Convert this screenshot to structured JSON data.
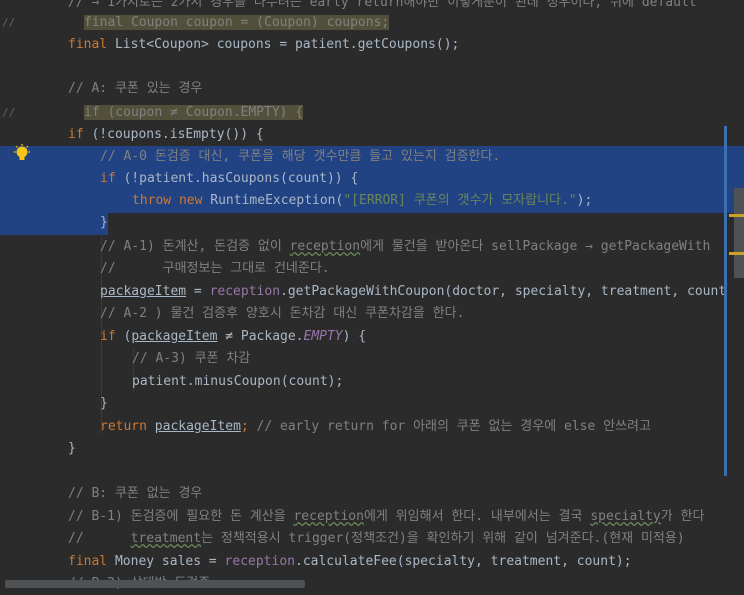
{
  "editor": {
    "lines": [
      {
        "gutter": "",
        "parts": [
          {
            "t": "// → 1가지로는 2가지 경우를 나누려는 early return해야만 이렇게분이 된데 정우이다, 뒤에 default",
            "c": "cm"
          }
        ]
      },
      {
        "gutter": "//",
        "parts": [
          {
            "t": "final Coupon coupon = (Coupon) coupons;",
            "c": "cm hl"
          }
        ]
      },
      {
        "gutter": "",
        "parts": [
          {
            "t": "final ",
            "c": "kw"
          },
          {
            "t": "List<Coupon> coupons = patient.getCoupons();",
            "c": ""
          }
        ]
      },
      {
        "gutter": "",
        "parts": []
      },
      {
        "gutter": "",
        "parts": [
          {
            "t": "// A: 쿠폰 있는 경우",
            "c": "cm"
          }
        ]
      },
      {
        "gutter": "//",
        "parts": [
          {
            "t": "if (coupon ≠ Coupon.EMPTY) {",
            "c": "cm hl"
          }
        ]
      },
      {
        "gutter": "",
        "parts": [
          {
            "t": "if ",
            "c": "kw"
          },
          {
            "t": "(!coupons.isEmpty()) {",
            "c": ""
          }
        ]
      },
      {
        "gutter": "",
        "parts": [
          {
            "t": "// A-0 돈검증 대신, 쿠폰을 해당 갯수만큼 들고 있는지 검증한다.",
            "c": "cm"
          }
        ]
      },
      {
        "gutter": "",
        "parts": [
          {
            "t": "if ",
            "c": "kw"
          },
          {
            "t": "(!patient.hasCoupons(count)) {",
            "c": ""
          }
        ]
      },
      {
        "gutter": "",
        "parts": [
          {
            "t": "throw new ",
            "c": "kw"
          },
          {
            "t": "RuntimeException(",
            "c": ""
          },
          {
            "t": "\"[ERROR] 쿠폰의 갯수가 모자랍니다.\"",
            "c": "str"
          },
          {
            "t": ");",
            "c": ""
          }
        ]
      },
      {
        "gutter": "",
        "parts": [
          {
            "t": "}",
            "c": ""
          }
        ]
      },
      {
        "gutter": "",
        "parts": [
          {
            "t": "// A-1) 돈계산, 돈검증 없이 ",
            "c": "cm"
          },
          {
            "t": "reception",
            "c": "cm sq"
          },
          {
            "t": "에게 물건을 받아온다 sellPackage → getPackageWith",
            "c": "cm"
          }
        ]
      },
      {
        "gutter": "",
        "parts": [
          {
            "t": "//      구매정보는 그대로 건네준다.",
            "c": "cm"
          }
        ]
      },
      {
        "gutter": "",
        "parts": [
          {
            "t": "packageItem",
            "c": "ul"
          },
          {
            "t": " = ",
            "c": ""
          },
          {
            "t": "reception",
            "c": "fld"
          },
          {
            "t": ".getPackageWithCoupon(doctor, specialty, treatment, count",
            "c": ""
          }
        ]
      },
      {
        "gutter": "",
        "parts": [
          {
            "t": "// A-2 ) 물건 검증후 양호시 돈차감 대신 쿠폰차감을 한다.",
            "c": "cm"
          }
        ]
      },
      {
        "gutter": "",
        "parts": [
          {
            "t": "if ",
            "c": "kw"
          },
          {
            "t": "(",
            "c": ""
          },
          {
            "t": "packageItem",
            "c": "ul"
          },
          {
            "t": " ≠ Package.",
            "c": ""
          },
          {
            "t": "EMPTY",
            "c": "it"
          },
          {
            "t": ") {",
            "c": ""
          }
        ]
      },
      {
        "gutter": "",
        "parts": [
          {
            "t": "// A-3) 쿠폰 차감",
            "c": "cm"
          }
        ]
      },
      {
        "gutter": "",
        "parts": [
          {
            "t": "patient.minusCoupon(count);",
            "c": ""
          }
        ]
      },
      {
        "gutter": "",
        "parts": [
          {
            "t": "}",
            "c": ""
          }
        ]
      },
      {
        "gutter": "",
        "parts": [
          {
            "t": "return ",
            "c": "kw"
          },
          {
            "t": "packageItem",
            "c": "ul"
          },
          {
            "t": "; ",
            "c": "kw"
          },
          {
            "t": "// early return for 아래의 쿠폰 없는 경우에 else 안쓰려고",
            "c": "cm"
          }
        ]
      },
      {
        "gutter": "",
        "parts": [
          {
            "t": "}",
            "c": ""
          }
        ]
      },
      {
        "gutter": "",
        "parts": []
      },
      {
        "gutter": "",
        "parts": [
          {
            "t": "// B: 쿠폰 없는 경우",
            "c": "cm"
          }
        ]
      },
      {
        "gutter": "",
        "parts": [
          {
            "t": "// B-1) 돈검증에 필요한 돈 계산을 ",
            "c": "cm"
          },
          {
            "t": "reception",
            "c": "cm sq"
          },
          {
            "t": "에게 위임해서 한다. 내부에서는 결국 ",
            "c": "cm"
          },
          {
            "t": "specialty",
            "c": "cm sq"
          },
          {
            "t": "가 한다",
            "c": "cm"
          }
        ]
      },
      {
        "gutter": "",
        "parts": [
          {
            "t": "//      ",
            "c": "cm"
          },
          {
            "t": "treatment",
            "c": "cm sq"
          },
          {
            "t": "는 정책적용시 trigger(정책조건)을 확인하기 위해 같이 넘겨준다.(현재 미적용)",
            "c": "cm"
          }
        ]
      },
      {
        "gutter": "",
        "parts": [
          {
            "t": "final ",
            "c": "kw"
          },
          {
            "t": "Money sales = ",
            "c": ""
          },
          {
            "t": "reception",
            "c": "fld"
          },
          {
            "t": ".calculateFee(specialty, treatment, count);",
            "c": ""
          }
        ]
      },
      {
        "gutter": "",
        "parts": [
          {
            "t": "// B-2) 상대방 돈검증",
            "c": "cm"
          }
        ]
      }
    ]
  }
}
